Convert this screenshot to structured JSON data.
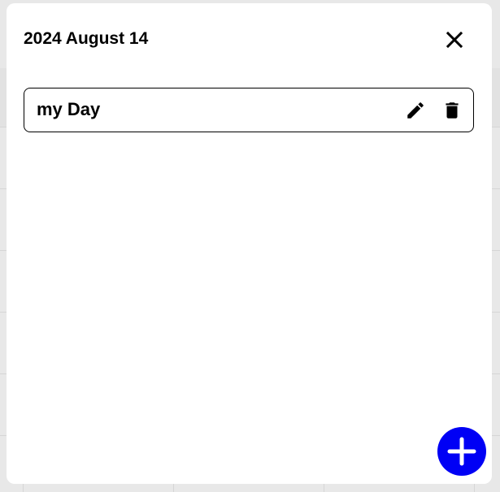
{
  "modal": {
    "title": "2024 August 14",
    "close_icon": "close-icon"
  },
  "events": [
    {
      "title": "my Day",
      "edit_icon": "pencil-icon",
      "delete_icon": "trash-icon"
    }
  ],
  "add_button": {
    "icon": "plus-icon",
    "color": "#0000f5"
  },
  "colors": {
    "backdrop": "#e6e6e6",
    "modal_bg": "#ffffff",
    "text": "#000000"
  }
}
